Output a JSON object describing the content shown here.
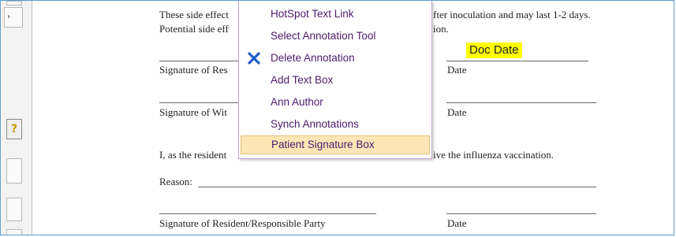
{
  "sidebar": {
    "nav_glyph": "›",
    "help_glyph": "?"
  },
  "document": {
    "paragraph1_line1_left": "These side effect",
    "paragraph1_line1_right": "fter inoculation and may last 1-2 days.",
    "paragraph1_line2_left": "Potential side eff",
    "paragraph1_line2_right": "ion.",
    "doc_date": "Doc Date",
    "sig_resident_label": "Signature of Res",
    "date_label_1": "Date",
    "sig_witness_label": "Signature of Wit",
    "date_label_2": "Date",
    "consent_left": "I, as the resident",
    "consent_right": "ive the influenza vaccination.",
    "reason_label": "Reason:",
    "sig_full_label": "Signature of Resident/Responsible Party",
    "date_label_3": "Date"
  },
  "context_menu": {
    "items": [
      {
        "label": "HotSpot Text Link",
        "icon": ""
      },
      {
        "label": "Select Annotation Tool",
        "icon": ""
      },
      {
        "label": "Delete Annotation",
        "icon": "delete-x-icon"
      },
      {
        "label": "Add Text Box",
        "icon": ""
      },
      {
        "label": "Ann Author",
        "icon": ""
      },
      {
        "label": "Synch Annotations",
        "icon": ""
      },
      {
        "label": "Patient Signature Box",
        "icon": "",
        "selected": true
      }
    ],
    "colors": {
      "text": "#4d1a6e",
      "highlight_bg": "#fde6b6",
      "highlight_border": "#e7bf74",
      "delete_icon": "#1f5fc8"
    }
  },
  "colors": {
    "doc_date_highlight": "#ffff00",
    "frame_border": "#5b9bd5"
  }
}
